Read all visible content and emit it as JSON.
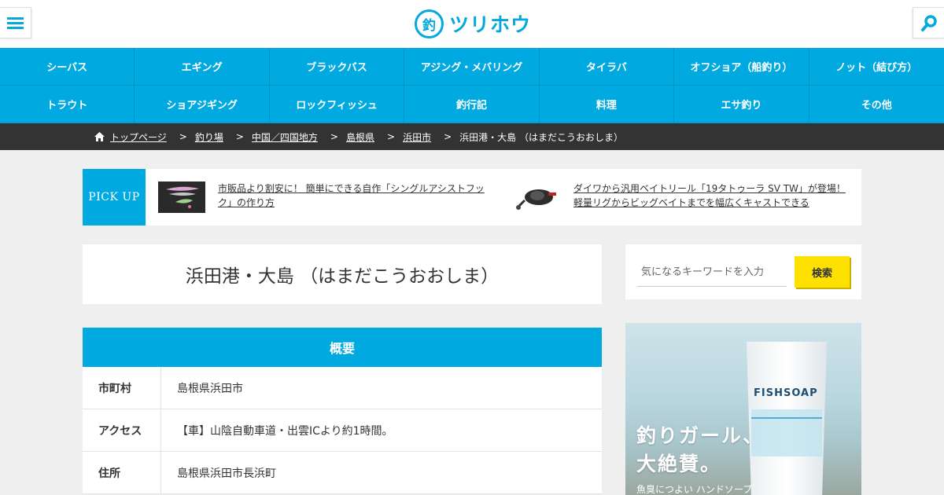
{
  "header": {
    "logo_mark": "釣",
    "logo_text": "ツリホウ"
  },
  "nav": {
    "items": [
      {
        "label": "シーバス"
      },
      {
        "label": "エギング"
      },
      {
        "label": "ブラックバス"
      },
      {
        "label": "アジング・メバリング"
      },
      {
        "label": "タイラバ"
      },
      {
        "label": "オフショア（船釣り）"
      },
      {
        "label": "ノット（結び方）"
      },
      {
        "label": "トラウト"
      },
      {
        "label": "ショアジギング"
      },
      {
        "label": "ロックフィッシュ"
      },
      {
        "label": "釣行記"
      },
      {
        "label": "料理"
      },
      {
        "label": "エサ釣り"
      },
      {
        "label": "その他"
      }
    ]
  },
  "breadcrumb": {
    "items": [
      {
        "label": "トップページ"
      },
      {
        "label": "釣り場"
      },
      {
        "label": "中国／四国地方"
      },
      {
        "label": "島根県"
      },
      {
        "label": "浜田市"
      }
    ],
    "current": "浜田港・大島 （はまだこうおおしま）",
    "separator": ">"
  },
  "pickup": {
    "label": "PICK UP",
    "items": [
      {
        "title": "市販品より割安に！ 簡単にできる自作「シングルアシストフック」の作り方"
      },
      {
        "title": "ダイワから汎用ベイトリール「19タトゥーラ SV TW」が登場！軽量リグからビッグベイトまでを幅広くキャストできる"
      }
    ]
  },
  "page_title": "浜田港・大島 （はまだこうおおしま）",
  "overview": {
    "heading": "概要",
    "rows": [
      {
        "key": "市町村",
        "value": "島根県浜田市"
      },
      {
        "key": "アクセス",
        "value": "【車】山陰自動車道・出雲ICより約1時間。"
      },
      {
        "key": "住所",
        "value": "島根県浜田市長浜町"
      }
    ]
  },
  "sidebar": {
    "search_placeholder": "気になるキーワードを入力",
    "search_button": "検索"
  },
  "ad": {
    "line1": "釣りガール、",
    "line2": "大絶賛。",
    "line3": "魚臭につよい ハンドソープ",
    "brand": "FISHSOAP"
  },
  "colors": {
    "accent": "#00a9df",
    "dark": "#333333",
    "button_yellow": "#ffe100",
    "background": "#efefef"
  },
  "icons": [
    "menu-icon",
    "search-icon",
    "home-icon"
  ]
}
